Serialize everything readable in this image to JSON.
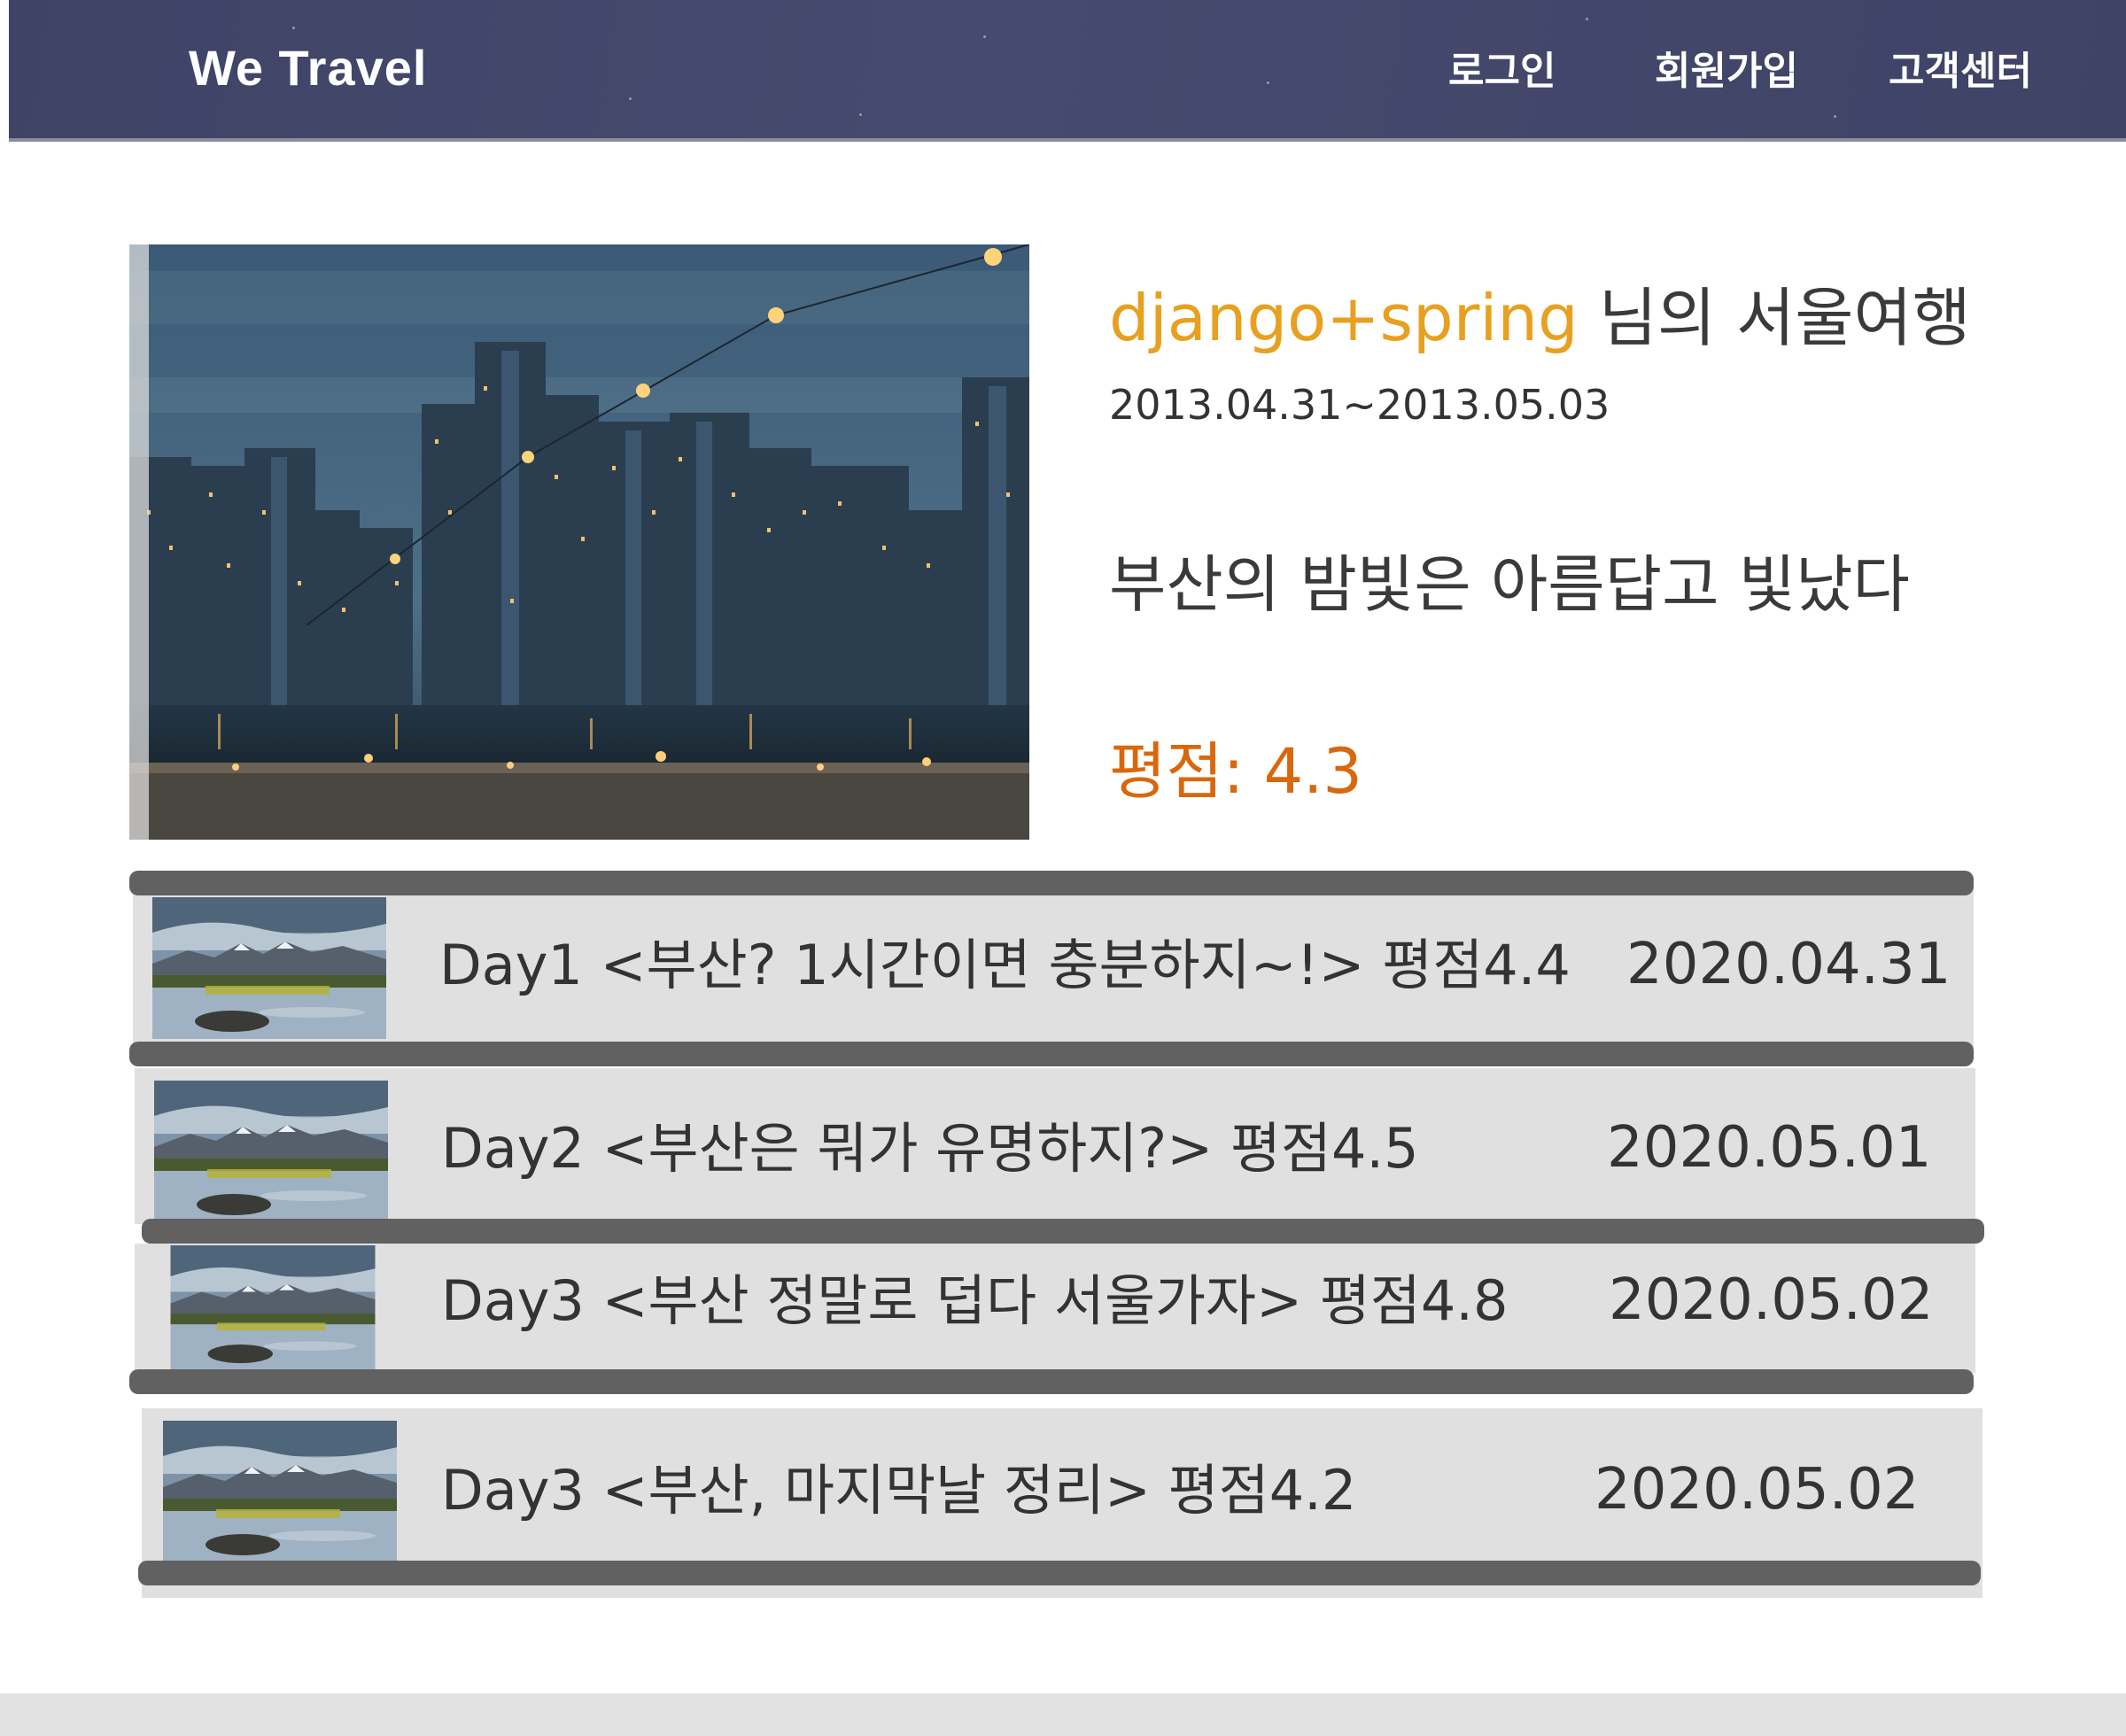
{
  "header": {
    "brand": "We Travel",
    "nav": {
      "login": "로그인",
      "signup": "회원가입",
      "support": "고객센터"
    }
  },
  "trip": {
    "user": "django+spring",
    "title_suffix": " 님의 서울여행",
    "dates": "2013.04.31~2013.05.03",
    "description": "부산의 밤빛은 아름답고 빛났다",
    "rating": "평점: 4.3"
  },
  "days": [
    {
      "title": "Day1 <부산? 1시간이면 충분하지~!> 평점4.4",
      "date": "2020.04.31"
    },
    {
      "title": "Day2 <부산은 뭐가 유명하지?>   평점4.5",
      "date": "2020.05.01"
    },
    {
      "title": "Day3 <부산 정말로 덥다 서울가자>     평점4.8",
      "date": "2020.05.02"
    },
    {
      "title": "Day3 <부산, 마지막날 정리>     평점4.2",
      "date": "2020.05.02"
    }
  ],
  "colors": {
    "header_bg": "#42466a",
    "username": "#e8a020",
    "rating": "#d9670e",
    "card_bg": "#e0e0e0",
    "card_bar": "#616161"
  }
}
